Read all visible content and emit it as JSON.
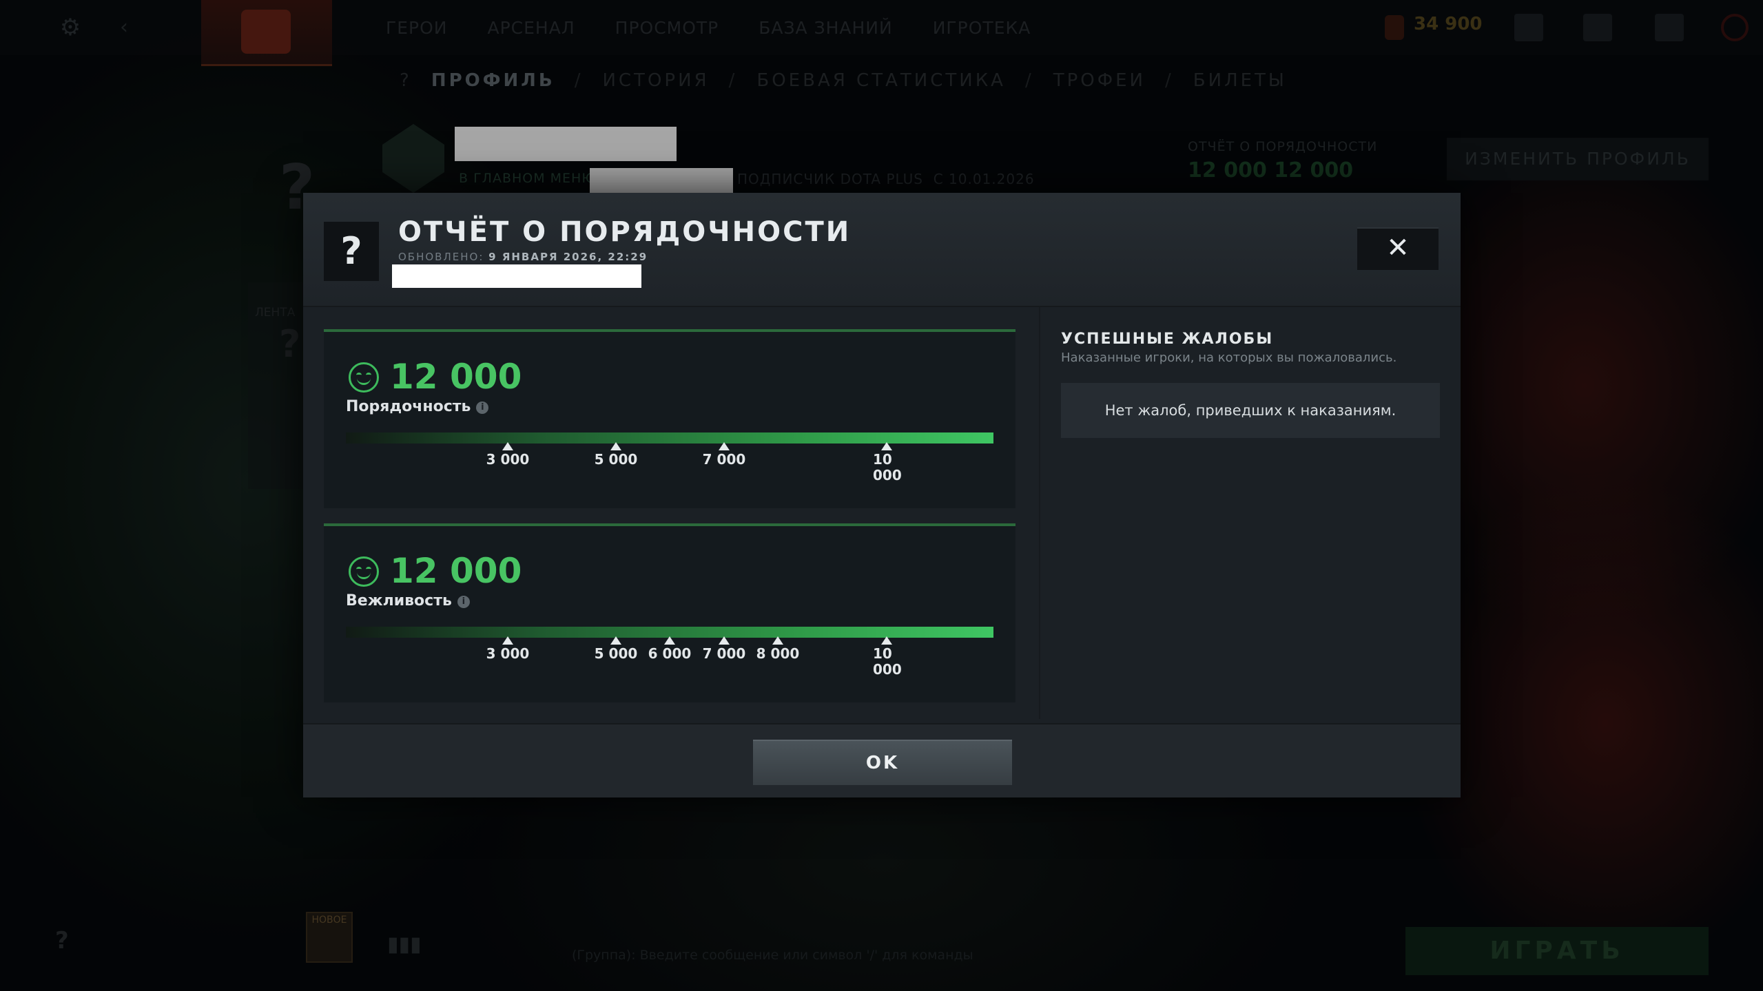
{
  "top_nav": {
    "items": [
      "ГЕРОИ",
      "АРСЕНАЛ",
      "ПРОСМОТР",
      "БАЗА ЗНАНИЙ",
      "ИГРОТЕКА"
    ],
    "currency": "34 900",
    "badge_count": "1"
  },
  "sub_nav": {
    "help": "?",
    "items": [
      "ПРОФИЛЬ",
      "ИСТОРИЯ",
      "БОЕВАЯ СТАТИСТИКА",
      "ТРОФЕИ",
      "БИЛЕТЫ"
    ],
    "separator": "/"
  },
  "profile": {
    "to_main_menu": "В ГЛАВНОМ МЕНЮ",
    "subscriber": "ПОДПИСЧИК DOTA PLUS",
    "since": "С 10.01.2026",
    "conduct_label": "ОТЧЁТ О ПОРЯДОЧНОСТИ",
    "conduct_values": "12 000   12 000",
    "edit_profile": "ИЗМЕНИТЬ ПРОФИЛЬ",
    "feed_label": "ЛЕНТА"
  },
  "bottom": {
    "new_tag": "НОВОЕ",
    "chat_placeholder": "(Группа): Введите сообщение или символ '/' для команды",
    "play": "ИГРАТЬ",
    "help": "?"
  },
  "modal": {
    "icon": "?",
    "title": "ОТЧЁТ О ПОРЯДОЧНОСТИ",
    "updated_label": "ОБНОВЛЕНО:",
    "updated_value": "9 ЯНВАРЯ 2026, 22:29",
    "close": "✕",
    "ok": "OK",
    "conduct_card": {
      "score": "12 000",
      "label": "Порядочность",
      "info_icon": "i",
      "value_fraction": 1.0,
      "ticks": [
        "3 000",
        "5 000",
        "7 000",
        "10 000"
      ]
    },
    "behavior_card": {
      "score": "12 000",
      "label": "Вежливость",
      "info_icon": "i",
      "value_fraction": 1.0,
      "ticks": [
        "3 000",
        "5 000",
        "6 000",
        "7 000",
        "8 000",
        "10 000"
      ]
    },
    "reports": {
      "title": "УСПЕШНЫЕ ЖАЛОБЫ",
      "subtitle": "Наказанные игроки, на которых вы пожаловались.",
      "empty": "Нет жалоб, приведших к наказаниям."
    }
  },
  "colors": {
    "accent_green": "#48c463",
    "modal_bg": "#1b2025",
    "card_bg": "#141a1e"
  }
}
